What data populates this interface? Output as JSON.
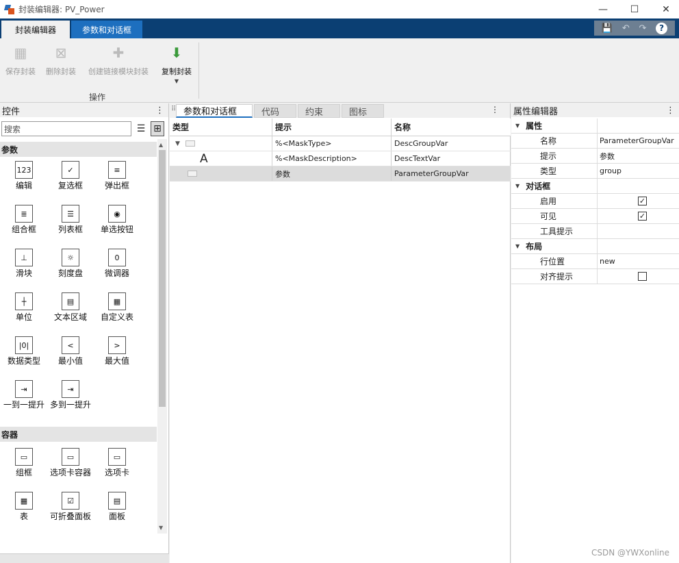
{
  "window": {
    "title": "封装编辑器: PV_Power",
    "minimize": "—",
    "maximize": "☐",
    "close": "✕"
  },
  "tabs": [
    {
      "label": "封装编辑器"
    },
    {
      "label": "参数和对话框"
    }
  ],
  "qat": {
    "save": "💾",
    "undo": "↶",
    "redo": "↷",
    "help": "?"
  },
  "toolstrip": {
    "tools": [
      {
        "label": "保存封装"
      },
      {
        "label": "删除封装"
      },
      {
        "label": "创建链接模块封装"
      },
      {
        "label": "复制封装"
      }
    ],
    "section": "操作"
  },
  "controls_panel": {
    "title": "控件",
    "search_placeholder": "搜索",
    "categories": [
      {
        "label": "参数"
      },
      {
        "label": "容器"
      }
    ],
    "params": [
      {
        "label": "编辑",
        "glyph": "123"
      },
      {
        "label": "复选框",
        "glyph": "✓"
      },
      {
        "label": "弹出框",
        "glyph": "≡"
      },
      {
        "label": "组合框",
        "glyph": "≣"
      },
      {
        "label": "列表框",
        "glyph": "☰"
      },
      {
        "label": "单选按钮",
        "glyph": "◉"
      },
      {
        "label": "滑块",
        "glyph": "⊥"
      },
      {
        "label": "刻度盘",
        "glyph": "☼"
      },
      {
        "label": "微调器",
        "glyph": "0"
      },
      {
        "label": "单位",
        "glyph": "┼"
      },
      {
        "label": "文本区域",
        "glyph": "▤"
      },
      {
        "label": "自定义表",
        "glyph": "▦"
      },
      {
        "label": "数据类型",
        "glyph": "|0|"
      },
      {
        "label": "最小值",
        "glyph": "<"
      },
      {
        "label": "最大值",
        "glyph": ">"
      },
      {
        "label": "一到一提升",
        "glyph": "⇥"
      },
      {
        "label": "多到一提升",
        "glyph": "⇥"
      }
    ],
    "containers": [
      {
        "label": "组框",
        "glyph": "▭"
      },
      {
        "label": "选项卡容器",
        "glyph": "▭"
      },
      {
        "label": "选项卡",
        "glyph": "▭"
      },
      {
        "label": "表",
        "glyph": "▦"
      },
      {
        "label": "可折叠面板",
        "glyph": "☑"
      },
      {
        "label": "面板",
        "glyph": "▤"
      }
    ]
  },
  "center": {
    "tabs": [
      {
        "label": "参数和对话框"
      },
      {
        "label": "代码"
      },
      {
        "label": "约束"
      },
      {
        "label": "图标"
      }
    ],
    "columns": [
      "类型",
      "提示",
      "名称"
    ],
    "rows": [
      {
        "type_glyph": "▾",
        "prompt": "%<MaskType>",
        "name": "DescGroupVar"
      },
      {
        "type_glyph": "A",
        "prompt": "%<MaskDescription>",
        "name": "DescTextVar"
      },
      {
        "type_glyph": "",
        "prompt": "参数",
        "name": "ParameterGroupVar"
      }
    ]
  },
  "properties": {
    "title": "属性编辑器",
    "groups": [
      {
        "label": "属性",
        "items": [
          {
            "key": "名称",
            "value": "ParameterGroupVar"
          },
          {
            "key": "提示",
            "value": "参数"
          },
          {
            "key": "类型",
            "value": "group"
          }
        ]
      },
      {
        "label": "对话框",
        "items": [
          {
            "key": "启用",
            "checked": true
          },
          {
            "key": "可见",
            "checked": true
          },
          {
            "key": "工具提示",
            "value": ""
          }
        ]
      },
      {
        "label": "布局",
        "items": [
          {
            "key": "行位置",
            "value": "new"
          },
          {
            "key": "对齐提示",
            "checked": false
          }
        ]
      }
    ]
  },
  "watermark": "CSDN @YWXonline"
}
